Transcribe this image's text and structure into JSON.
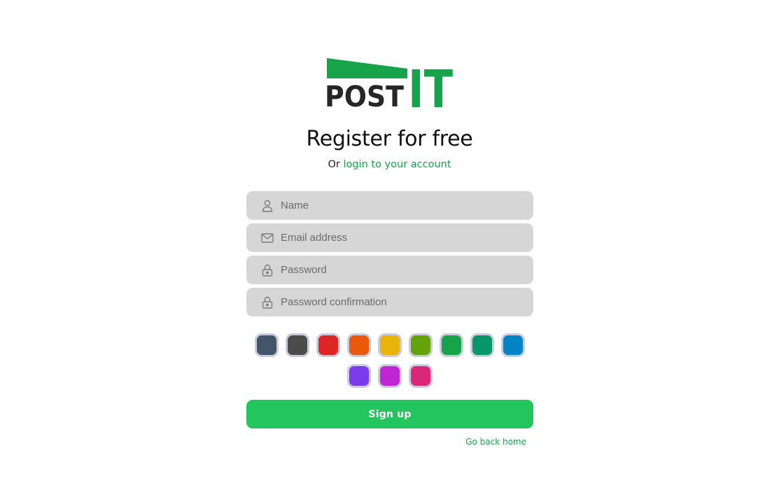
{
  "logo": {
    "word_dark": "POST",
    "word_accent": "IT",
    "dark_color": "#262626",
    "accent_color": "#17a34a"
  },
  "heading": "Register for free",
  "subline": {
    "prefix": "Or",
    "link_label": "login to your account"
  },
  "form": {
    "name": {
      "placeholder": "Name",
      "icon": "user-icon"
    },
    "email": {
      "placeholder": "Email address",
      "icon": "envelope-icon"
    },
    "password": {
      "placeholder": "Password",
      "icon": "lock-icon"
    },
    "password_confirmation": {
      "placeholder": "Password confirmation",
      "icon": "lock-icon"
    }
  },
  "colors": [
    "#445469",
    "#4b4b4b",
    "#dc2626",
    "#ea580c",
    "#eab308",
    "#65a30d",
    "#16a34a",
    "#059669",
    "#0284c7",
    "#7c3aed",
    "#c026d3",
    "#db2777"
  ],
  "swatch_border_color": "#c9cbe0",
  "signup_button": {
    "label": "Sign up",
    "color": "#22c55e"
  },
  "go_back_home": "Go back home",
  "link_color": "#17a34a"
}
